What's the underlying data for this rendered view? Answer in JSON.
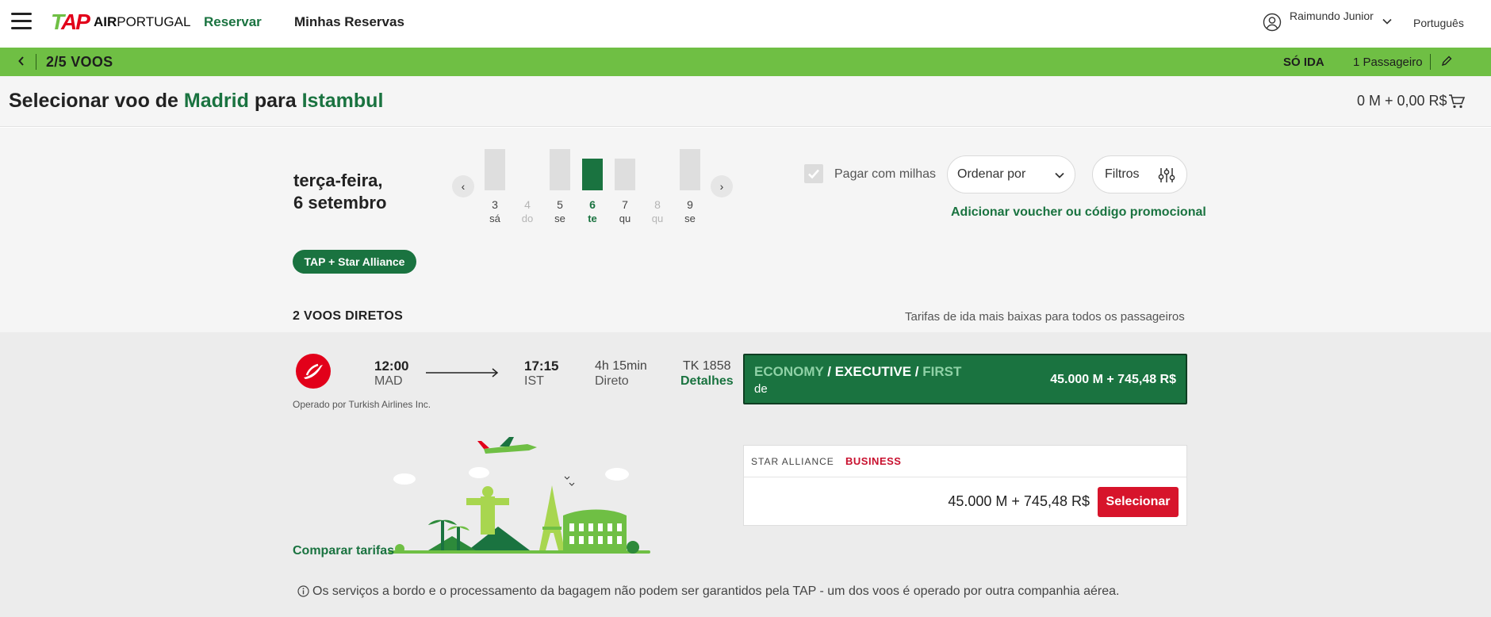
{
  "colors": {
    "brand_green": "#1a7340",
    "bar_green": "#6fbf44",
    "logo_red": "#e2001a",
    "select_red": "#d7142b",
    "bg_gray": "#f5f5f5"
  },
  "nav": {
    "logo_mark": "TAP",
    "logo_text_bold": "AIR",
    "logo_text": "PORTUGAL",
    "links": [
      "Reservar",
      "Minhas Reservas"
    ],
    "user_name": "Raimundo Junior",
    "language": "Português",
    "icons": [
      "menu-icon",
      "user-icon",
      "chevron-down-icon"
    ]
  },
  "progress_bar": {
    "steps": "2/5 VOOS",
    "trip_type": "SÓ IDA",
    "passengers": "1 Passageiro",
    "icons": [
      "chevron-left-icon",
      "pencil-icon"
    ]
  },
  "title": {
    "prefix": "Selecionar voo de",
    "origin": "Madrid",
    "middle": "para",
    "destination": "Istambul",
    "cart_total": "0 M + 0,00 R$",
    "cart_icon": "cart-icon"
  },
  "calendar": {
    "date_line1": "terça-feira,",
    "date_line2": "6 setembro",
    "days": [
      {
        "num": "3",
        "wd": "sá",
        "available": true,
        "selected": false
      },
      {
        "num": "4",
        "wd": "do",
        "available": false,
        "selected": false
      },
      {
        "num": "5",
        "wd": "se",
        "available": true,
        "selected": false
      },
      {
        "num": "6",
        "wd": "te",
        "available": true,
        "selected": true
      },
      {
        "num": "7",
        "wd": "qu",
        "available": true,
        "selected": false
      },
      {
        "num": "8",
        "wd": "qu",
        "available": false,
        "selected": false
      },
      {
        "num": "9",
        "wd": "se",
        "available": true,
        "selected": false
      }
    ],
    "prev_label": "‹",
    "next_label": "›"
  },
  "filters": {
    "pay_with_miles": "Pagar com milhas",
    "pay_with_miles_checked": true,
    "sort_label": "Ordenar por",
    "filters_label": "Filtros",
    "voucher_link": "Adicionar voucher ou código promocional",
    "alliance_tag": "TAP + Star Alliance"
  },
  "results": {
    "count_label": "2 VOOS DIRETOS",
    "lowest_note": "Tarifas de ida mais baixas para todos os passageiros",
    "flight": {
      "departure_time": "12:00",
      "departure_airport": "MAD",
      "arrival_time": "17:15",
      "arrival_airport": "IST",
      "duration": "4h 15min",
      "stops": "Direto",
      "flight_number": "TK 1858",
      "details_link": "Detalhes",
      "operated_by": "Operado por Turkish Airlines Inc.",
      "fare_economy": "ECONOMY",
      "fare_sep1": " / ",
      "fare_executive": "EXECUTIVE",
      "fare_sep2": " / ",
      "fare_first": "FIRST",
      "fare_from": "de",
      "fare_price": "45.000 M + 745,48 R$"
    },
    "business_card": {
      "alliance": "STAR ALLIANCE",
      "class": "BUSINESS",
      "price": "45.000 M + 745,48 R$",
      "select_label": "Selecionar"
    },
    "compare_link": "Comparar tarifas",
    "notice": "Os serviços a bordo e o processamento da bagagem não podem ser garantidos pela TAP - um dos voos é operado por outra companhia aérea."
  }
}
